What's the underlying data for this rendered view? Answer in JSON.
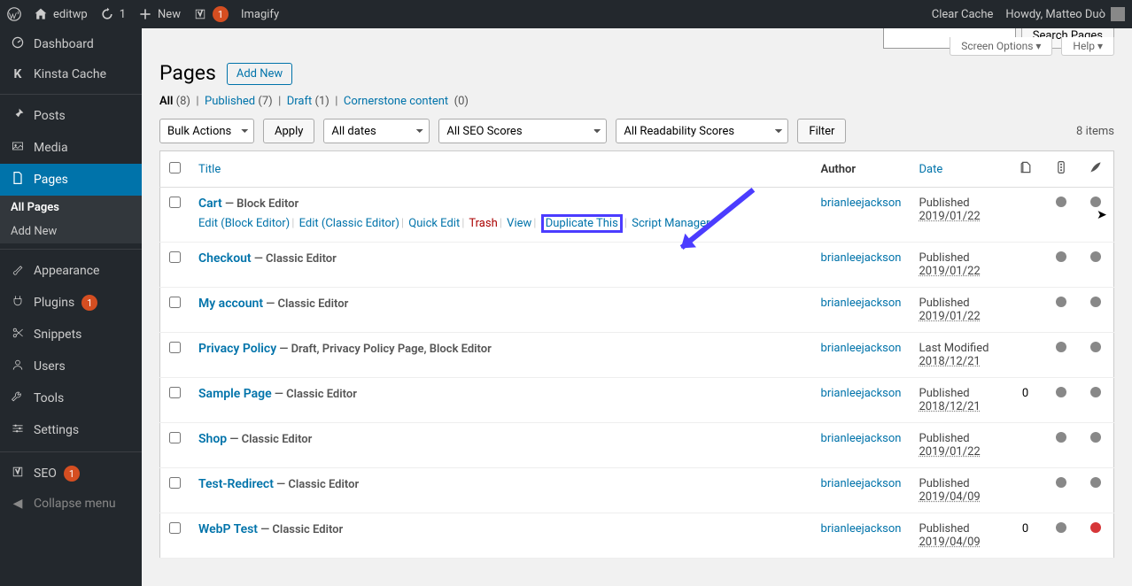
{
  "adminbar": {
    "site": "editwp",
    "updates": "1",
    "new": "New",
    "imagify": "Imagify",
    "clear_cache": "Clear Cache",
    "greeting": "Howdy, Matteo Duò"
  },
  "sidebar": {
    "dashboard": "Dashboard",
    "kinsta": "Kinsta Cache",
    "posts": "Posts",
    "media": "Media",
    "pages": "Pages",
    "pages_sub_all": "All Pages",
    "pages_sub_add": "Add New",
    "appearance": "Appearance",
    "plugins": "Plugins",
    "plugins_badge": "1",
    "snippets": "Snippets",
    "users": "Users",
    "tools": "Tools",
    "settings": "Settings",
    "seo": "SEO",
    "seo_badge": "1",
    "collapse": "Collapse menu"
  },
  "screen_meta": {
    "options": "Screen Options ▾",
    "help": "Help ▾"
  },
  "heading": "Pages",
  "add_new": "Add New",
  "views": {
    "all": "All",
    "all_count": "(8)",
    "pub": "Published",
    "pub_count": "(7)",
    "draft": "Draft",
    "draft_count": "(1)",
    "corner": "Cornerstone content",
    "corner_count": "(0)"
  },
  "search": {
    "button": "Search Pages"
  },
  "filters": {
    "bulk": "Bulk Actions",
    "apply": "Apply",
    "dates": "All dates",
    "seo": "All SEO Scores",
    "read": "All Readability Scores",
    "filter": "Filter",
    "items": "8 items"
  },
  "cols": {
    "title": "Title",
    "author": "Author",
    "date": "Date"
  },
  "row_actions": {
    "edit_block": "Edit (Block Editor)",
    "edit_classic": "Edit (Classic Editor)",
    "quick": "Quick Edit",
    "trash": "Trash",
    "view": "View",
    "dup": "Duplicate This",
    "script": "Script Manager"
  },
  "rows": [
    {
      "title": "Cart",
      "state": " — Block Editor",
      "author": "brianleejackson",
      "date_l": "Published",
      "date_v": "2019/01/22",
      "c1": "",
      "d2": "g"
    },
    {
      "title": "Checkout",
      "state": " — Classic Editor",
      "author": "brianleejackson",
      "date_l": "Published",
      "date_v": "2019/01/22",
      "c1": "",
      "d2": "g"
    },
    {
      "title": "My account",
      "state": " — Classic Editor",
      "author": "brianleejackson",
      "date_l": "Published",
      "date_v": "2019/01/22",
      "c1": "",
      "d2": "g"
    },
    {
      "title": "Privacy Policy",
      "state": " — Draft, Privacy Policy Page, Block Editor",
      "author": "brianleejackson",
      "date_l": "Last Modified",
      "date_v": "2018/12/21",
      "c1": "",
      "d2": "g"
    },
    {
      "title": "Sample Page",
      "state": " — Classic Editor",
      "author": "brianleejackson",
      "date_l": "Published",
      "date_v": "2018/12/21",
      "c1": "0",
      "d2": "g"
    },
    {
      "title": "Shop",
      "state": " — Classic Editor",
      "author": "brianleejackson",
      "date_l": "Published",
      "date_v": "2019/01/22",
      "c1": "",
      "d2": "g"
    },
    {
      "title": "Test-Redirect",
      "state": " — Classic Editor",
      "author": "brianleejackson",
      "date_l": "Published",
      "date_v": "2019/04/09",
      "c1": "",
      "d2": "g"
    },
    {
      "title": "WebP Test",
      "state": " — Classic Editor",
      "author": "brianleejackson",
      "date_l": "Published",
      "date_v": "2019/04/09",
      "c1": "0",
      "d2": "r"
    }
  ]
}
